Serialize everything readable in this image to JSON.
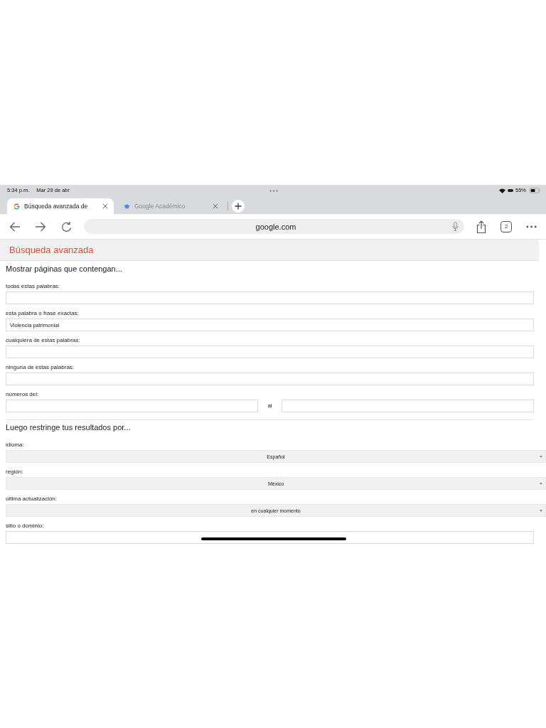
{
  "status_bar": {
    "time": "5:34 p.m.",
    "date": "Mar 29 de abr",
    "battery": "55%"
  },
  "tabs": [
    {
      "title": "Búsqueda avanzada de",
      "selected": true
    },
    {
      "title": "Google Académico",
      "selected": false
    }
  ],
  "toolbar": {
    "url": "google.com",
    "tab_count": "2"
  },
  "page": {
    "title": "Búsqueda avanzada",
    "sections": [
      {
        "heading": "Mostrar páginas que contengan...",
        "fields": [
          {
            "kind": "text",
            "label": "todas estas palabras:"
          },
          {
            "kind": "text",
            "label": "esta palabra o frase exactas:",
            "value": "Violencia patrimonial"
          },
          {
            "kind": "text",
            "label": "cualquiera de estas palabras:"
          },
          {
            "kind": "text",
            "label": "ninguna de estas palabras:"
          },
          {
            "kind": "range",
            "label": "números del:",
            "separator": "al"
          }
        ]
      },
      {
        "heading": "Luego restringe tus resultados por...",
        "fields": [
          {
            "kind": "select",
            "label": "idioma:",
            "value": "Español"
          },
          {
            "kind": "select",
            "label": "región:",
            "value": "México"
          },
          {
            "kind": "select",
            "label": "última actualización:",
            "value": "en cualquier momento"
          },
          {
            "kind": "text",
            "label": "sitio o dominio:"
          }
        ]
      }
    ]
  }
}
